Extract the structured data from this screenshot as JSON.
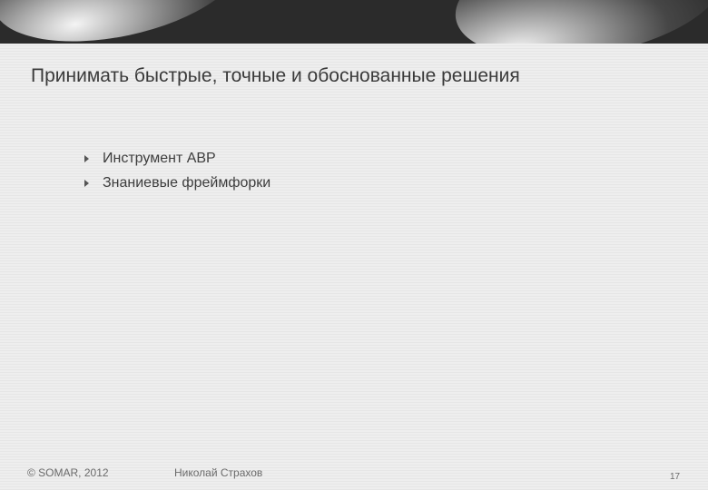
{
  "slide": {
    "title": "Принимать быстрые, точные и обоснованные решения",
    "bullets": [
      {
        "label": "Инструмент ABP"
      },
      {
        "label": "Знаниевые фреймфорки"
      }
    ]
  },
  "footer": {
    "copyright": "© SOMAR, 2012",
    "author": "Николай Страхов",
    "page_number": "17"
  }
}
